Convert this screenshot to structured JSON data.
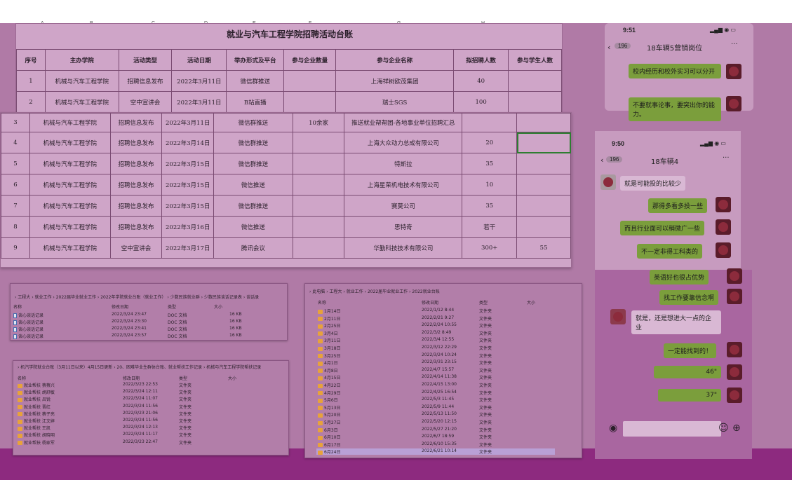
{
  "sheet": {
    "col_letters": [
      "A",
      "B",
      "C",
      "D",
      "E",
      "F",
      "G",
      "H"
    ],
    "title": "就业与汽车工程学院招聘活动台账",
    "headers": [
      "序号",
      "主办学院",
      "活动类型",
      "活动日期",
      "举办形式及平台",
      "参与企业数量",
      "参与企业名称",
      "拟招聘人数",
      "参与学生人数"
    ],
    "rows": [
      [
        "1",
        "机械与汽车工程学院",
        "招聘信息发布",
        "2022年3月11日",
        "微信群推送",
        "",
        "上海祥树欧茂集团",
        "40",
        ""
      ],
      [
        "2",
        "机械与汽车工程学院",
        "空中宣讲会",
        "2022年3月11日",
        "B站直播",
        "",
        "瑞士SGS",
        "100",
        ""
      ],
      [
        "3",
        "机械与汽车工程学院",
        "招聘信息发布",
        "2022年3月11日",
        "微信群推送",
        "10余家",
        "推送就业帮帮团-各地事业单位招聘汇总",
        "",
        ""
      ],
      [
        "4",
        "机械与汽车工程学院",
        "招聘信息发布",
        "2022年3月14日",
        "微信群推送",
        "",
        "上海大众动力总成有限公司",
        "20",
        ""
      ],
      [
        "5",
        "机械与汽车工程学院",
        "招聘信息发布",
        "2022年3月15日",
        "微信群推送",
        "",
        "特斯拉",
        "35",
        ""
      ],
      [
        "6",
        "机械与汽车工程学院",
        "招聘信息发布",
        "2022年3月15日",
        "微信推送",
        "",
        "上海星荣机电技术有限公司",
        "10",
        ""
      ],
      [
        "7",
        "机械与汽车工程学院",
        "招聘信息发布",
        "2022年3月15日",
        "微信群推送",
        "",
        "赛莫公司",
        "35",
        ""
      ],
      [
        "8",
        "机械与汽车工程学院",
        "招聘信息发布",
        "2022年3月16日",
        "微信推送",
        "",
        "思特奇",
        "若干",
        ""
      ],
      [
        "9",
        "机械与汽车工程学院",
        "空中宣讲会",
        "2022年3月17日",
        "腾讯会议",
        "",
        "华勤科技技术有限公司",
        "300+",
        "55"
      ]
    ]
  },
  "phone_top": {
    "time": "9:51",
    "back_count": "196",
    "chat_title": "18车辆5营销岗位",
    "more": "···",
    "messages": [
      "校内经历和校外实习可以分开",
      "不要就事论事，要突出你的能力。"
    ]
  },
  "phone_bottom": {
    "time": "9:50",
    "back_count": "196",
    "chat_title": "18车辆4",
    "more": "···",
    "messages_in": [
      "就是可能投的比较少",
      "就是，还是想进大一点的企业"
    ],
    "messages_out": [
      "那得多看多投一些",
      "而且行业面可以稍微广一些",
      "不一定非得工科类的",
      "英语好也很占优势",
      "找工作要靠信念啊",
      "一定能找到的！",
      "46\"",
      "37\""
    ]
  },
  "explorer1": {
    "breadcrumb": "› 工程大 › 就业工作 › 2022届毕业就业工作 › 2022年学院就业台账（就业工作） › 少数民族就业群 › 少数民族谈话记录表 › 谈话录",
    "headers": [
      "名称",
      "修改日期",
      "类型",
      "大小"
    ],
    "rows": [
      [
        "谈心谈话记录",
        "2022/3/24 23:47",
        "DOC 文档",
        "16 KB"
      ],
      [
        "谈心谈话记录",
        "2022/3/24 23:30",
        "DOC 文档",
        "16 KB"
      ],
      [
        "谈心谈话记录",
        "2022/3/24 23:41",
        "DOC 文档",
        "16 KB"
      ],
      [
        "谈心谈话记录",
        "2022/3/24 23:57",
        "DOC 文档",
        "16 KB"
      ]
    ]
  },
  "explorer2": {
    "breadcrumb": "› 机汽学院就业台账（3月11日以来）4月15日更新 › 20、困难毕业生群体台账、就业帮扶工作记录 › 机械与汽车工程学院帮扶记录",
    "headers": [
      "名称",
      "修改日期",
      "类型",
      "大小"
    ],
    "rows": [
      [
        "就业帮扶 蔡蔡兴",
        "2022/3/23 22:53",
        "文件夹"
      ],
      [
        "就业帮扶 胡舒敏",
        "2022/3/24 12:11",
        "文件夹"
      ],
      [
        "就业帮扶 吕锐",
        "2022/3/24 11:07",
        "文件夹"
      ],
      [
        "就业帮扶 晋红",
        "2022/3/24 11:56",
        "文件夹"
      ],
      [
        "就业帮扶 蔡子亮",
        "2022/3/23 21:06",
        "文件夹"
      ],
      [
        "就业帮扶 江文婷",
        "2022/3/24 11:56",
        "文件夹"
      ],
      [
        "就业帮扶 王凯",
        "2022/3/24 12:13",
        "文件夹"
      ],
      [
        "就业帮扶 胡晓明",
        "2022/3/24 11:17",
        "文件夹"
      ],
      [
        "就业帮扶 杨家军",
        "2022/3/23 22:47",
        "文件夹"
      ]
    ]
  },
  "explorer3": {
    "breadcrumb": "› 此电脑 › 工程大 › 就业工作 › 2022届毕业就业工作 › 2022就业台账",
    "headers": [
      "名称",
      "修改日期",
      "类型",
      "大小"
    ],
    "rows": [
      [
        "1月14日",
        "2022/1/12 8:44",
        "文件夹"
      ],
      [
        "2月11日",
        "2022/2/21 9:27",
        "文件夹"
      ],
      [
        "2月25日",
        "2022/2/24 10:55",
        "文件夹"
      ],
      [
        "3月4日",
        "2022/3/2 8:49",
        "文件夹"
      ],
      [
        "3月11日",
        "2022/3/4 12:55",
        "文件夹"
      ],
      [
        "3月18日",
        "2022/3/12 22:29",
        "文件夹"
      ],
      [
        "3月25日",
        "2022/3/24 10:24",
        "文件夹"
      ],
      [
        "4月1日",
        "2022/3/31 23:15",
        "文件夹"
      ],
      [
        "4月8日",
        "2022/4/7 15:57",
        "文件夹"
      ],
      [
        "4月15日",
        "2022/4/14 11:38",
        "文件夹"
      ],
      [
        "4月22日",
        "2022/4/15 13:00",
        "文件夹"
      ],
      [
        "4月29日",
        "2022/4/25 16:54",
        "文件夹"
      ],
      [
        "5月6日",
        "2022/5/3 11:45",
        "文件夹"
      ],
      [
        "5月13日",
        "2022/5/9 11:44",
        "文件夹"
      ],
      [
        "5月20日",
        "2022/5/13 11:50",
        "文件夹"
      ],
      [
        "5月27日",
        "2022/5/20 12:15",
        "文件夹"
      ],
      [
        "6月3日",
        "2022/5/27 21:20",
        "文件夹"
      ],
      [
        "6月10日",
        "2022/6/7 18:59",
        "文件夹"
      ],
      [
        "6月17日",
        "2022/6/10 15:35",
        "文件夹"
      ],
      [
        "6月24日",
        "2022/6/21 10:14",
        "文件夹"
      ]
    ],
    "selected_index": 19
  }
}
